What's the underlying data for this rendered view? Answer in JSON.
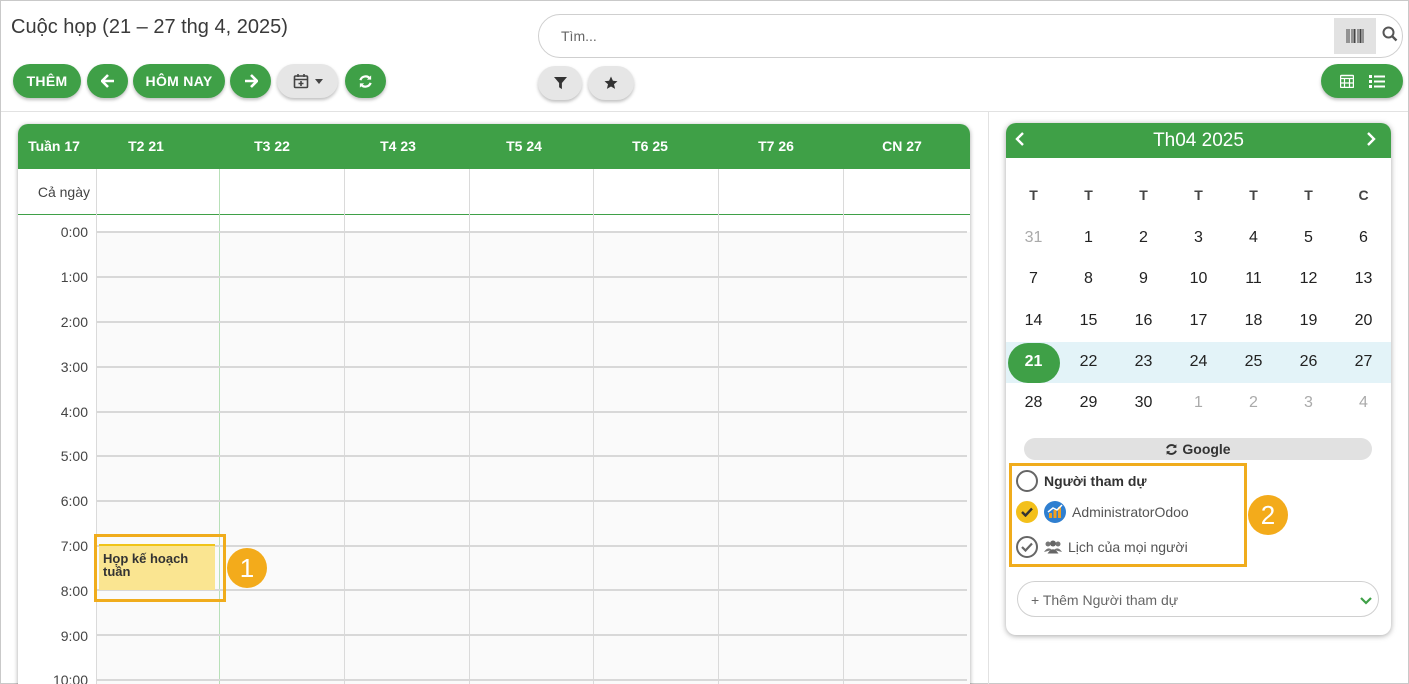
{
  "header": {
    "title": "Cuộc họp (21 – 27 thg 4, 2025)",
    "add_label": "THÊM",
    "today_label": "HÔM NAY",
    "search_placeholder": "Tìm..."
  },
  "colors": {
    "accent": "#3fa047",
    "event": "#fae591",
    "highlight": "#f0ac1c",
    "week_row": "#e3f3f8"
  },
  "calendar": {
    "week_label": "Tuần 17",
    "days": [
      "T2 21",
      "T3 22",
      "T4 23",
      "T5 24",
      "T6 25",
      "T7 26",
      "CN 27"
    ],
    "all_day_label": "Cả ngày",
    "hours": [
      "0:00",
      "1:00",
      "2:00",
      "3:00",
      "4:00",
      "5:00",
      "6:00",
      "7:00",
      "8:00",
      "9:00",
      "10:00"
    ],
    "event": {
      "title": "Họp kế hoạch tuần"
    }
  },
  "callouts": {
    "one": "1",
    "two": "2"
  },
  "mini_calendar": {
    "title": "Th04 2025",
    "weekdays": [
      "T",
      "T",
      "T",
      "T",
      "T",
      "T",
      "C"
    ],
    "weeks": [
      [
        "31",
        "1",
        "2",
        "3",
        "4",
        "5",
        "6"
      ],
      [
        "7",
        "8",
        "9",
        "10",
        "11",
        "12",
        "13"
      ],
      [
        "14",
        "15",
        "16",
        "17",
        "18",
        "19",
        "20"
      ],
      [
        "21",
        "22",
        "23",
        "24",
        "25",
        "26",
        "27"
      ],
      [
        "28",
        "29",
        "30",
        "1",
        "2",
        "3",
        "4"
      ]
    ],
    "today": "21"
  },
  "sidebar": {
    "google_label": "Google",
    "attendees_header": "Người tham dự",
    "attendee_admin": "AdministratorOdoo",
    "attendee_everyone": "Lịch của mọi người",
    "add_attendee": "+ Thêm Người tham dự"
  }
}
